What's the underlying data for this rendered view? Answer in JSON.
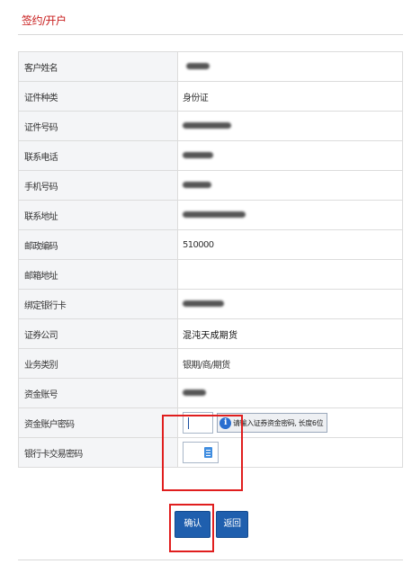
{
  "page": {
    "title": "签约/开户"
  },
  "rows": [
    {
      "label": "客户姓名",
      "value": ""
    },
    {
      "label": "证件种类",
      "value": "身份证"
    },
    {
      "label": "证件号码",
      "value": ""
    },
    {
      "label": "联系电话",
      "value": ""
    },
    {
      "label": "手机号码",
      "value": ""
    },
    {
      "label": "联系地址",
      "value": ""
    },
    {
      "label": "邮政编码",
      "value": "510000"
    },
    {
      "label": "邮箱地址",
      "value": ""
    },
    {
      "label": "绑定银行卡",
      "value": ""
    },
    {
      "label": "证券公司",
      "value": "混沌天成期货"
    },
    {
      "label": "业务类别",
      "value": "银期/商/期货"
    },
    {
      "label": "资金账号",
      "value": ""
    },
    {
      "label": "资金账户密码",
      "value": ""
    },
    {
      "label": "银行卡交易密码",
      "value": ""
    }
  ],
  "password_hint": "请输入证券资金密码, 长度6位",
  "buttons": {
    "confirm": "确认",
    "back": "返回"
  },
  "colors": {
    "title": "#c81c1c",
    "button": "#1f5fae",
    "highlight": "#e01e1e"
  }
}
